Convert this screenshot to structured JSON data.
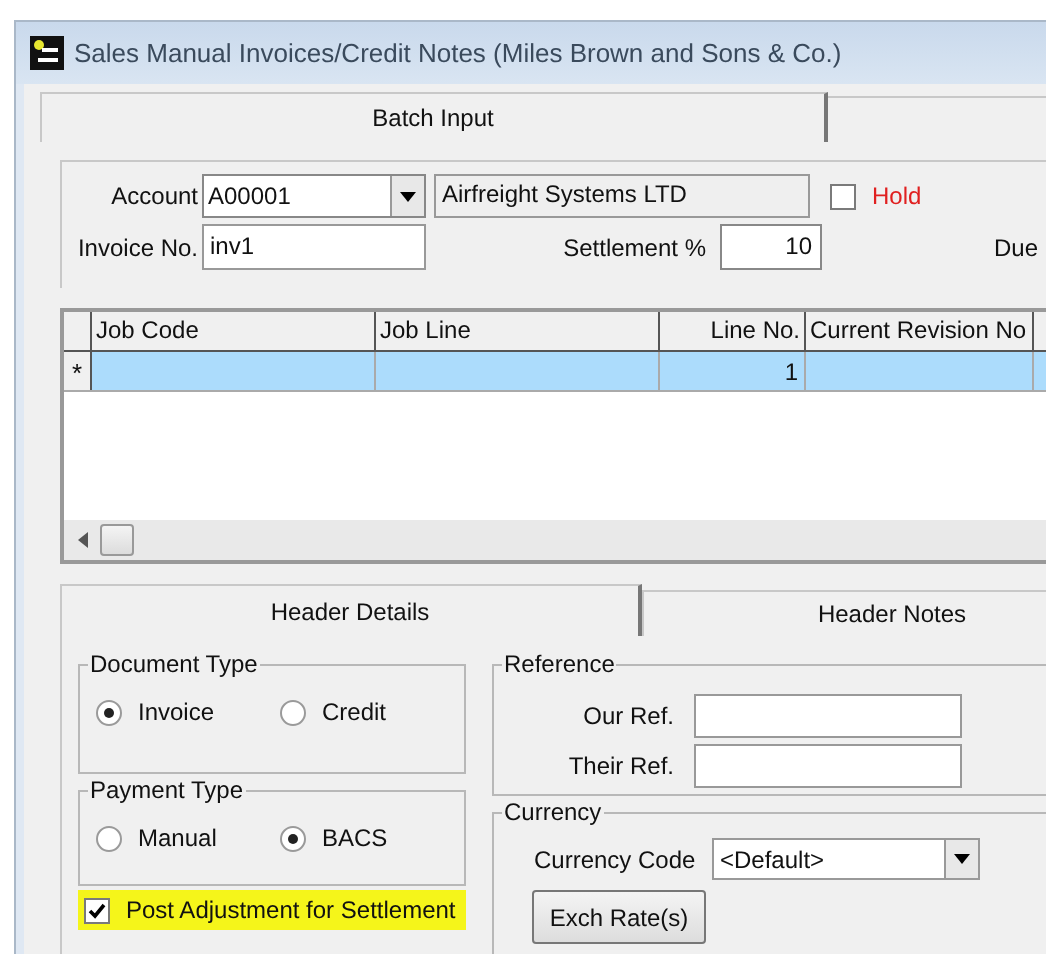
{
  "window": {
    "title": "Sales Manual Invoices/Credit Notes (Miles Brown and Sons & Co.)"
  },
  "top_tabs": [
    {
      "label": "Batch Input",
      "selected": true
    }
  ],
  "account": {
    "label": "Account",
    "value": "A00001",
    "name": "Airfreight Systems LTD"
  },
  "hold": {
    "label": "Hold",
    "checked": false
  },
  "invoice_no": {
    "label": "Invoice No.",
    "value": "inv1"
  },
  "settlement": {
    "label": "Settlement %",
    "value": "10"
  },
  "due_label": "Due",
  "grid": {
    "columns": [
      "Job Code",
      "Job Line",
      "Line No.",
      "Current Revision No"
    ],
    "rows": [
      {
        "marker": "*",
        "selected": true,
        "line_no": "1"
      }
    ]
  },
  "detail_tabs": [
    {
      "label": "Header Details",
      "selected": true
    },
    {
      "label": "Header Notes",
      "selected": false
    }
  ],
  "document_type": {
    "title": "Document Type",
    "options": [
      {
        "label": "Invoice",
        "selected": true
      },
      {
        "label": "Credit",
        "selected": false
      }
    ]
  },
  "payment_type": {
    "title": "Payment Type",
    "options": [
      {
        "label": "Manual",
        "selected": false
      },
      {
        "label": "BACS",
        "selected": true
      }
    ]
  },
  "post_adjustment": {
    "label": "Post Adjustment for Settlement",
    "checked": true,
    "highlighted": true
  },
  "reference": {
    "title": "Reference",
    "fields": [
      {
        "label": "Our Ref."
      },
      {
        "label": "Their Ref."
      }
    ]
  },
  "currency": {
    "title": "Currency",
    "code_label": "Currency Code",
    "code_value": "<Default>",
    "button": "Exch Rate(s)"
  }
}
